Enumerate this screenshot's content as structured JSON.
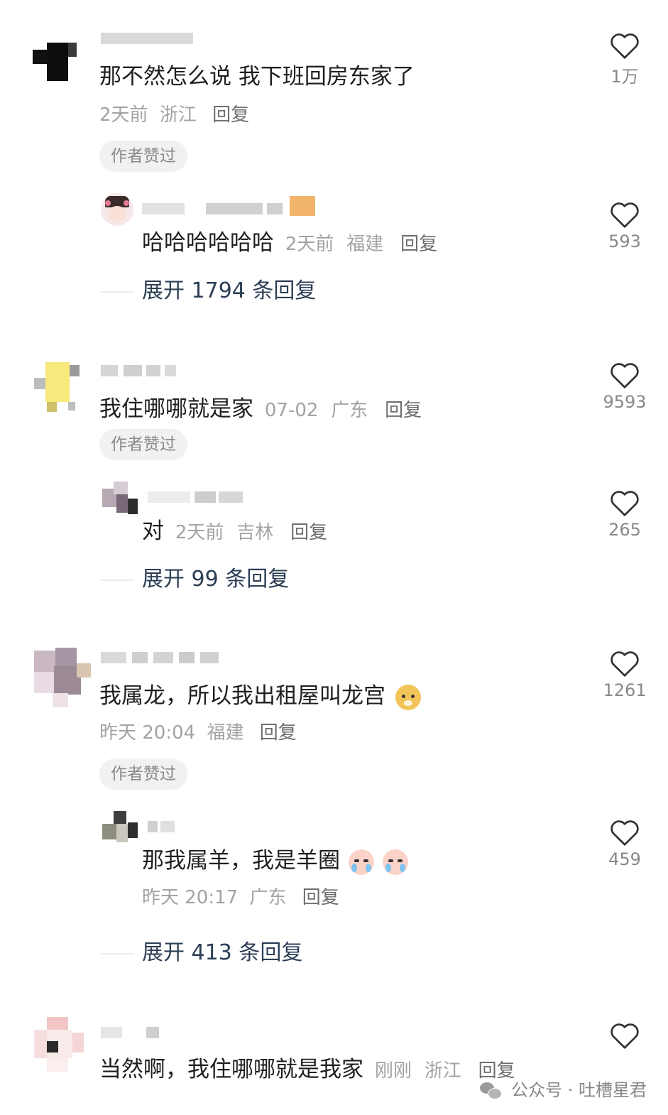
{
  "comments": [
    {
      "text": "那不然怎么说 我下班回房东家了",
      "time": "2天前",
      "location": "浙江",
      "reply": "回复",
      "likes": "1万",
      "author_liked": "作者赞过",
      "sub": {
        "text": "哈哈哈哈哈哈",
        "time": "2天前",
        "location": "福建",
        "reply": "回复",
        "likes": "593"
      },
      "expand": "展开 1794 条回复"
    },
    {
      "text": "我住哪哪就是家",
      "time": "07-02",
      "location": "广东",
      "reply": "回复",
      "likes": "9593",
      "author_liked": "作者赞过",
      "sub": {
        "text": "对",
        "time": "2天前",
        "location": "吉林",
        "reply": "回复",
        "likes": "265"
      },
      "expand": "展开 99 条回复"
    },
    {
      "text": "我属龙，所以我出租屋叫龙宫",
      "time": "昨天 20:04",
      "location": "福建",
      "reply": "回复",
      "likes": "1261",
      "author_liked": "作者赞过",
      "sub": {
        "text": "那我属羊，我是羊圈",
        "time": "昨天 20:17",
        "location": "广东",
        "reply": "回复",
        "likes": "459"
      },
      "expand": "展开 413 条回复"
    },
    {
      "text": "当然啊，我住哪哪就是我家",
      "time": "刚刚",
      "location": "浙江",
      "reply": "回复",
      "likes": ""
    }
  ],
  "watermark": "公众号 · 吐槽星君",
  "colors": {
    "text": "#1f1f1f",
    "meta": "#a3a3a3",
    "expand": "#2c3e55",
    "badge_bg": "#f1f1f1"
  },
  "icons": {
    "like": "heart-outline-icon",
    "watermark": "wechat-icon"
  }
}
